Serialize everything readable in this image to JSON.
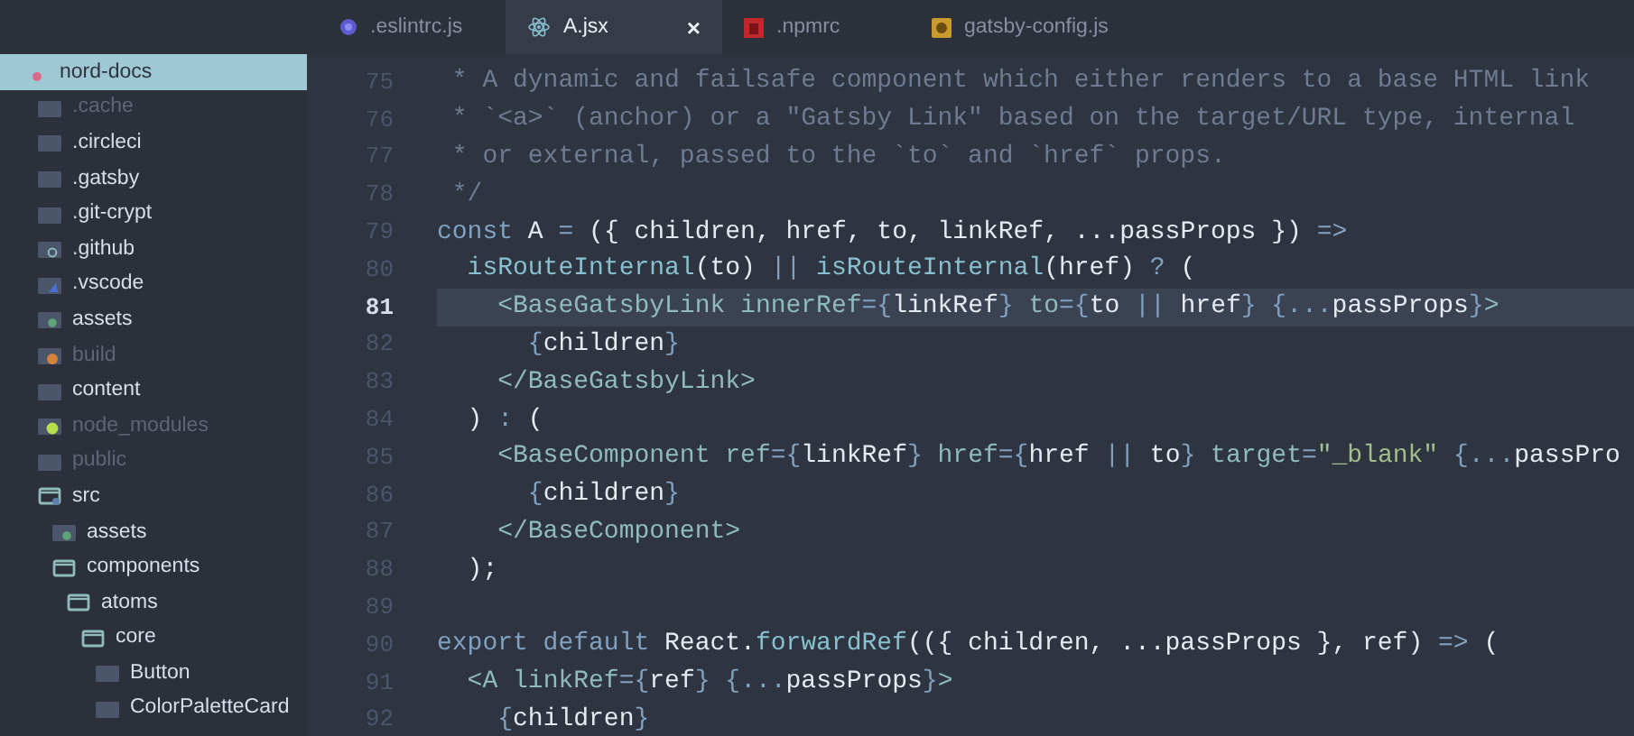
{
  "tabs": [
    {
      "label": ".eslintrc.js",
      "kind": "eslint",
      "selected": false
    },
    {
      "label": "A.jsx",
      "kind": "react",
      "selected": true,
      "close": "×"
    },
    {
      "label": ".npmrc",
      "kind": "npm",
      "selected": false
    },
    {
      "label": "gatsby-config.js",
      "kind": "gatsby",
      "selected": false
    }
  ],
  "tree": [
    {
      "label": "nord-docs",
      "kind": "repo",
      "selected": true,
      "children": [
        {
          "label": ".cache",
          "kind": "folder",
          "selected": false,
          "expanded": false,
          "dimmed": true
        },
        {
          "label": ".circleci",
          "kind": "folder",
          "selected": false,
          "expanded": false,
          "dimmed": false
        },
        {
          "label": ".gatsby",
          "kind": "folder",
          "selected": false,
          "expanded": false,
          "dimmed": false
        },
        {
          "label": ".git-crypt",
          "kind": "folder",
          "selected": false,
          "expanded": false,
          "dimmed": false
        },
        {
          "label": ".github",
          "kind": "github",
          "selected": false,
          "expanded": false,
          "dimmed": false
        },
        {
          "label": ".vscode",
          "kind": "vscode",
          "selected": false,
          "expanded": false,
          "dimmed": false
        },
        {
          "label": "assets",
          "kind": "assets",
          "selected": false,
          "expanded": false,
          "dimmed": false
        },
        {
          "label": "build",
          "kind": "build",
          "selected": false,
          "expanded": false,
          "dimmed": true
        },
        {
          "label": "content",
          "kind": "folder",
          "selected": false,
          "expanded": false,
          "dimmed": false
        },
        {
          "label": "node_modules",
          "kind": "node",
          "selected": false,
          "expanded": false,
          "dimmed": true
        },
        {
          "label": "public",
          "kind": "folder",
          "selected": false,
          "expanded": false,
          "dimmed": true
        },
        {
          "label": "src",
          "kind": "src",
          "selected": false,
          "expanded": true,
          "dimmed": false,
          "children": [
            {
              "label": "assets",
              "kind": "assets",
              "selected": false,
              "expanded": false,
              "dimmed": false
            },
            {
              "label": "components",
              "kind": "folder",
              "selected": false,
              "expanded": true,
              "dimmed": false,
              "children": [
                {
                  "label": "atoms",
                  "kind": "folder",
                  "selected": false,
                  "expanded": true,
                  "dimmed": false,
                  "children": [
                    {
                      "label": "core",
                      "kind": "folder",
                      "selected": false,
                      "expanded": true,
                      "dimmed": false,
                      "children": [
                        {
                          "label": "Button",
                          "kind": "folder",
                          "selected": false,
                          "expanded": false,
                          "dimmed": false
                        },
                        {
                          "label": "ColorPaletteCard",
                          "kind": "folder",
                          "selected": false,
                          "expanded": false,
                          "dimmed": false
                        }
                      ]
                    }
                  ]
                }
              ]
            }
          ]
        }
      ]
    }
  ],
  "code": [
    {
      "number": "75",
      "active": false,
      "tokens": [
        {
          "kind": "comment",
          "text": " * A dynamic and failsafe component which either renders to a base HTML link"
        }
      ]
    },
    {
      "number": "76",
      "active": false,
      "tokens": [
        {
          "kind": "comment",
          "text": " * `<a>` (anchor) or a \"Gatsby Link\" based on the target/URL type, internal"
        }
      ]
    },
    {
      "number": "77",
      "active": false,
      "tokens": [
        {
          "kind": "comment",
          "text": " * or external, passed to the `to` and `href` props."
        }
      ]
    },
    {
      "number": "78",
      "active": false,
      "tokens": [
        {
          "kind": "comment",
          "text": " */"
        }
      ]
    },
    {
      "number": "79",
      "active": false,
      "tokens": [
        {
          "kind": "keyword",
          "text": "const"
        },
        {
          "kind": "plain",
          "text": " A "
        },
        {
          "kind": "op",
          "text": "="
        },
        {
          "kind": "plain",
          "text": " ({ children, href, to, linkRef, ...passProps }) "
        },
        {
          "kind": "op",
          "text": "=>"
        }
      ]
    },
    {
      "number": "80",
      "active": false,
      "tokens": [
        {
          "kind": "func",
          "text": "  isRouteInternal"
        },
        {
          "kind": "plain",
          "text": "(to) "
        },
        {
          "kind": "op",
          "text": "||"
        },
        {
          "kind": "func",
          "text": " isRouteInternal"
        },
        {
          "kind": "plain",
          "text": "(href) "
        },
        {
          "kind": "op",
          "text": "?"
        },
        {
          "kind": "plain",
          "text": " ("
        }
      ]
    },
    {
      "number": "81",
      "active": true,
      "tokens": [
        {
          "kind": "tag",
          "text": "    <BaseGatsbyLink"
        },
        {
          "kind": "attr",
          "text": " innerRef"
        },
        {
          "kind": "op",
          "text": "={"
        },
        {
          "kind": "plain",
          "text": "linkRef"
        },
        {
          "kind": "op",
          "text": "}"
        },
        {
          "kind": "attr",
          "text": " to"
        },
        {
          "kind": "op",
          "text": "={"
        },
        {
          "kind": "plain",
          "text": "to "
        },
        {
          "kind": "op",
          "text": "||"
        },
        {
          "kind": "plain",
          "text": " href"
        },
        {
          "kind": "op",
          "text": "} {..."
        },
        {
          "kind": "plain",
          "text": "passProps"
        },
        {
          "kind": "op",
          "text": "}"
        },
        {
          "kind": "tag",
          "text": ">"
        }
      ]
    },
    {
      "number": "82",
      "active": false,
      "tokens": [
        {
          "kind": "op",
          "text": "      {"
        },
        {
          "kind": "plain",
          "text": "children"
        },
        {
          "kind": "op",
          "text": "}"
        }
      ]
    },
    {
      "number": "83",
      "active": false,
      "tokens": [
        {
          "kind": "tag",
          "text": "    </BaseGatsbyLink>"
        }
      ]
    },
    {
      "number": "84",
      "active": false,
      "tokens": [
        {
          "kind": "plain",
          "text": "  ) "
        },
        {
          "kind": "op",
          "text": ":"
        },
        {
          "kind": "plain",
          "text": " ("
        }
      ]
    },
    {
      "number": "85",
      "active": false,
      "tokens": [
        {
          "kind": "tag",
          "text": "    <BaseComponent"
        },
        {
          "kind": "attr",
          "text": " ref"
        },
        {
          "kind": "op",
          "text": "={"
        },
        {
          "kind": "plain",
          "text": "linkRef"
        },
        {
          "kind": "op",
          "text": "}"
        },
        {
          "kind": "attr",
          "text": " href"
        },
        {
          "kind": "op",
          "text": "={"
        },
        {
          "kind": "plain",
          "text": "href "
        },
        {
          "kind": "op",
          "text": "||"
        },
        {
          "kind": "plain",
          "text": " to"
        },
        {
          "kind": "op",
          "text": "}"
        },
        {
          "kind": "attr",
          "text": " target"
        },
        {
          "kind": "op",
          "text": "="
        },
        {
          "kind": "string",
          "text": "\"_blank\""
        },
        {
          "kind": "op",
          "text": " {..."
        },
        {
          "kind": "plain",
          "text": "passPro"
        }
      ]
    },
    {
      "number": "86",
      "active": false,
      "tokens": [
        {
          "kind": "op",
          "text": "      {"
        },
        {
          "kind": "plain",
          "text": "children"
        },
        {
          "kind": "op",
          "text": "}"
        }
      ]
    },
    {
      "number": "87",
      "active": false,
      "tokens": [
        {
          "kind": "tag",
          "text": "    </BaseComponent>"
        }
      ]
    },
    {
      "number": "88",
      "active": false,
      "tokens": [
        {
          "kind": "plain",
          "text": "  );"
        }
      ]
    },
    {
      "number": "89",
      "active": false
    },
    {
      "number": "90",
      "active": false,
      "tokens": [
        {
          "kind": "keyword",
          "text": "export default"
        },
        {
          "kind": "plain",
          "text": " React."
        },
        {
          "kind": "func",
          "text": "forwardRef"
        },
        {
          "kind": "plain",
          "text": "(({ children, ...passProps }, ref) "
        },
        {
          "kind": "op",
          "text": "=>"
        },
        {
          "kind": "plain",
          "text": " ("
        }
      ]
    },
    {
      "number": "91",
      "active": false,
      "tokens": [
        {
          "kind": "tag",
          "text": "  <A"
        },
        {
          "kind": "attr",
          "text": " linkRef"
        },
        {
          "kind": "op",
          "text": "={"
        },
        {
          "kind": "plain",
          "text": "ref"
        },
        {
          "kind": "op",
          "text": "} {..."
        },
        {
          "kind": "plain",
          "text": "passProps"
        },
        {
          "kind": "op",
          "text": "}"
        },
        {
          "kind": "tag",
          "text": ">"
        }
      ]
    },
    {
      "number": "92",
      "active": false,
      "tokens": [
        {
          "kind": "op",
          "text": "    {"
        },
        {
          "kind": "plain",
          "text": "children"
        },
        {
          "kind": "op",
          "text": "}"
        }
      ]
    }
  ]
}
